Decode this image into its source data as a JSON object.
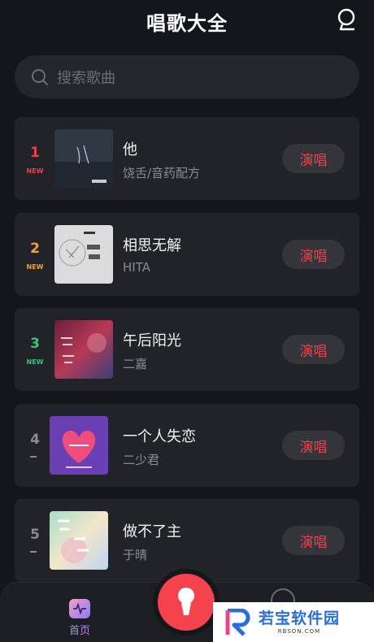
{
  "header": {
    "title": "唱歌大全"
  },
  "search": {
    "placeholder": "搜索歌曲"
  },
  "songs": [
    {
      "rank": "1",
      "tag": "NEW",
      "title": "他",
      "artist": "饶舌/音药配方",
      "action": "演唱",
      "rank_color": "#e8414a"
    },
    {
      "rank": "2",
      "tag": "NEW",
      "title": "相思无解",
      "artist": "HITA",
      "action": "演唱",
      "rank_color": "#f0a23a"
    },
    {
      "rank": "3",
      "tag": "NEW",
      "title": "午后阳光",
      "artist": "二嘉",
      "action": "演唱",
      "rank_color": "#3cc27a"
    },
    {
      "rank": "4",
      "tag": "",
      "title": "一个人失恋",
      "artist": "二少君",
      "action": "演唱",
      "rank_color": "#8a8a8f"
    },
    {
      "rank": "5",
      "tag": "",
      "title": "做不了主",
      "artist": "于晴",
      "action": "演唱",
      "rank_color": "#8a8a8f"
    }
  ],
  "tabbar": {
    "home_label": "首页"
  },
  "watermark": {
    "title": "若宝软件园",
    "sub": "RBSON.COM"
  },
  "colors": {
    "accent": "#f4434c",
    "sing_text": "#e8414a",
    "background": "#15161b",
    "card": "#222329"
  }
}
